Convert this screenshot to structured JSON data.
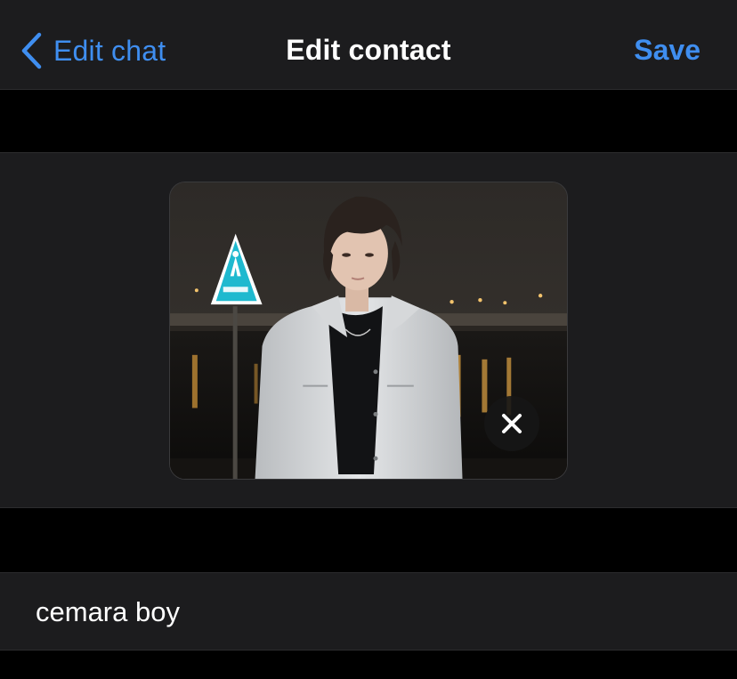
{
  "navbar": {
    "back_label": "Edit chat",
    "title": "Edit contact",
    "save_label": "Save",
    "back_icon": "chevron-left-icon"
  },
  "photo": {
    "description_icon": "contact-photo",
    "remove_icon": "close-icon"
  },
  "contact": {
    "name_value": "cemara boy"
  },
  "colors": {
    "accent": "#3f8ef0",
    "background": "#000000",
    "cell": "#1c1c1e",
    "text": "#ffffff",
    "sign": "#1fb9cf"
  }
}
